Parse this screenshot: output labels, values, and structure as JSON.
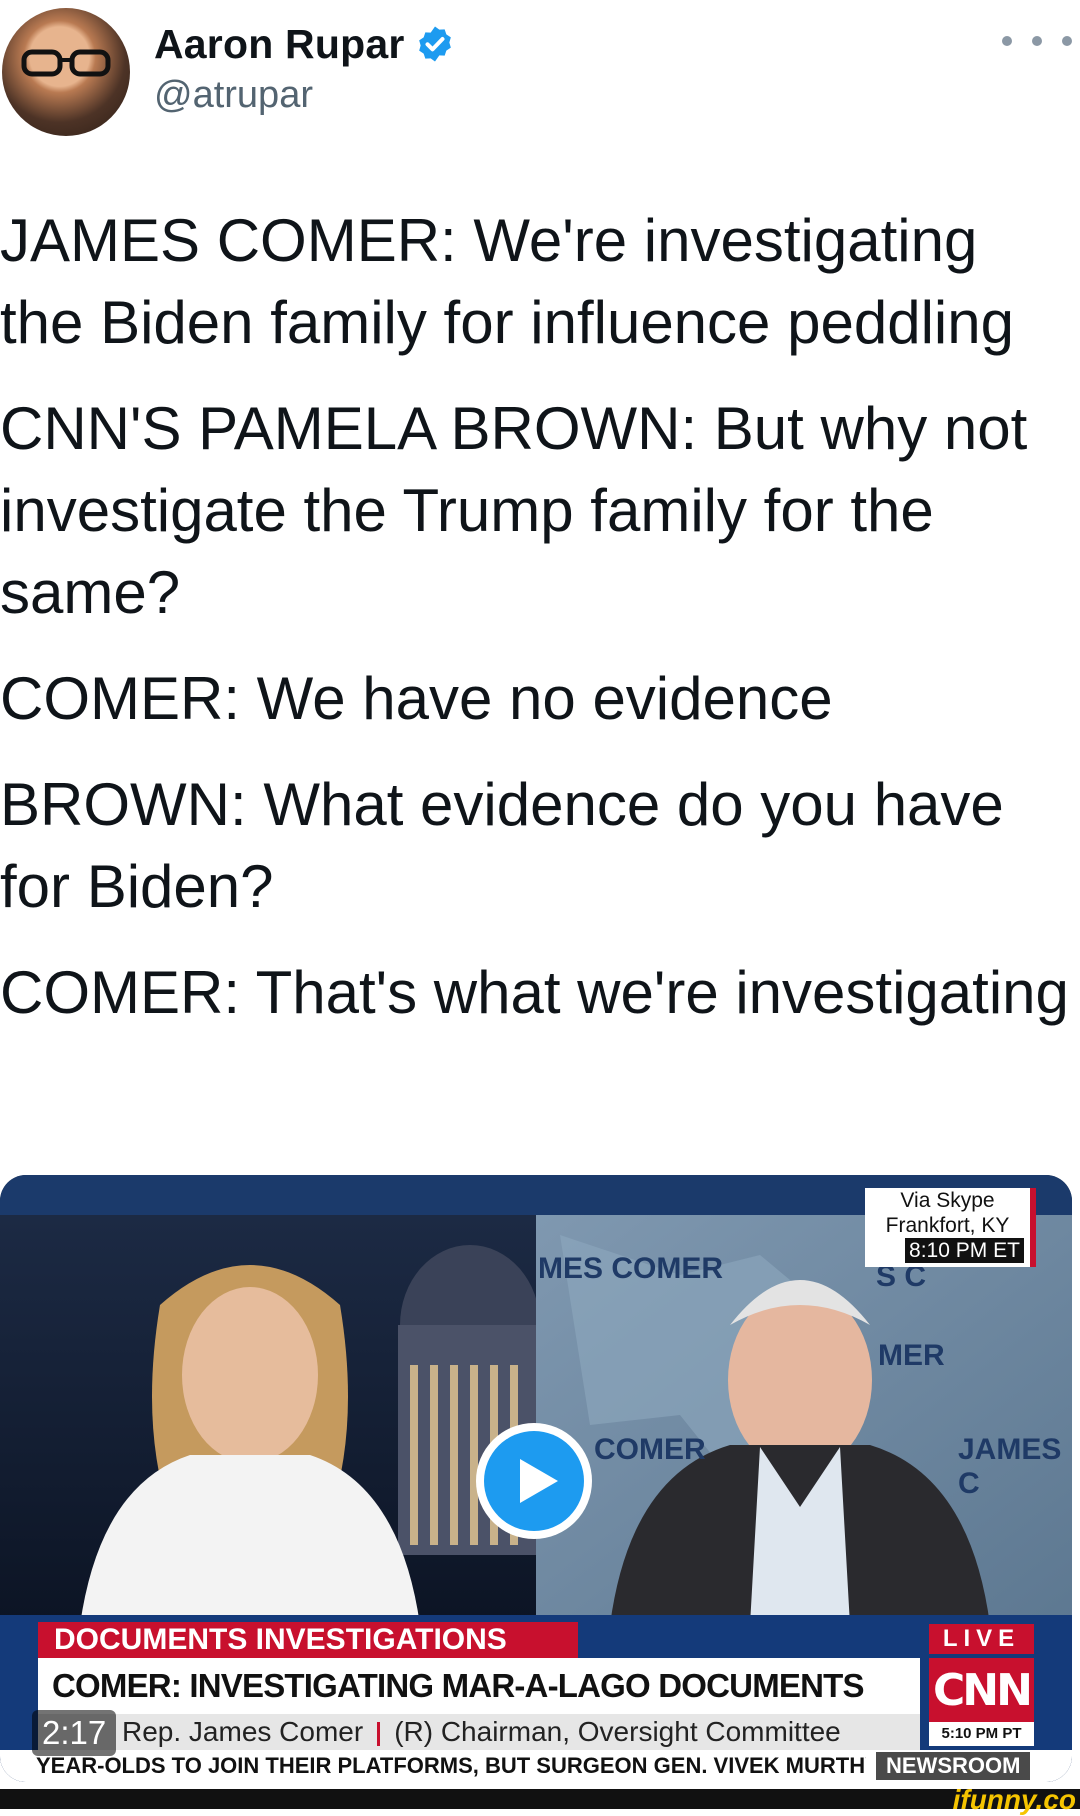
{
  "author": {
    "name": "Aaron Rupar",
    "handle": "@atrupar",
    "verified": true
  },
  "tweet": {
    "paragraphs": [
      "JAMES COMER: We're investigating the Biden family for influence peddling",
      "CNN'S PAMELA BROWN: But why not investigate the Trump family for the same?",
      "COMER: We have no evidence",
      "BROWN: What evidence do you have for Biden?",
      "COMER: That's what we're investigating"
    ]
  },
  "video": {
    "duration": "2:17",
    "via_box": {
      "line1": "Via Skype",
      "line2": "Frankfort, KY",
      "time": "8:10 PM ET"
    },
    "backdrop_plates": [
      "MES COMER",
      "COMER",
      "S C",
      "MER",
      "JAMES C"
    ],
    "chyron": {
      "topic": "DOCUMENTS INVESTIGATIONS",
      "headline": "COMER: INVESTIGATING MAR-A-LAGO DOCUMENTS \"NOT A PRIORITY\"",
      "sub_name": "Rep. James Comer",
      "sub_title": "(R) Chairman, Oversight Committee",
      "ticker": "YEAR-OLDS TO JOIN THEIR PLATFORMS, BUT SURGEON GEN. VIVEK MURTHY",
      "show": "NEWSROOM"
    },
    "network": {
      "live": "LIVE",
      "logo": "CNN",
      "time": "5:10 PM PT"
    }
  },
  "watermark": "ifunny.co",
  "icons": {
    "verified": "verified-badge-icon",
    "more": "more-options-icon",
    "play": "play-icon"
  },
  "colors": {
    "verified_blue": "#1d9bf0",
    "cnn_red": "#c8102e",
    "text": "#0f1419",
    "handle_gray": "#536471"
  }
}
